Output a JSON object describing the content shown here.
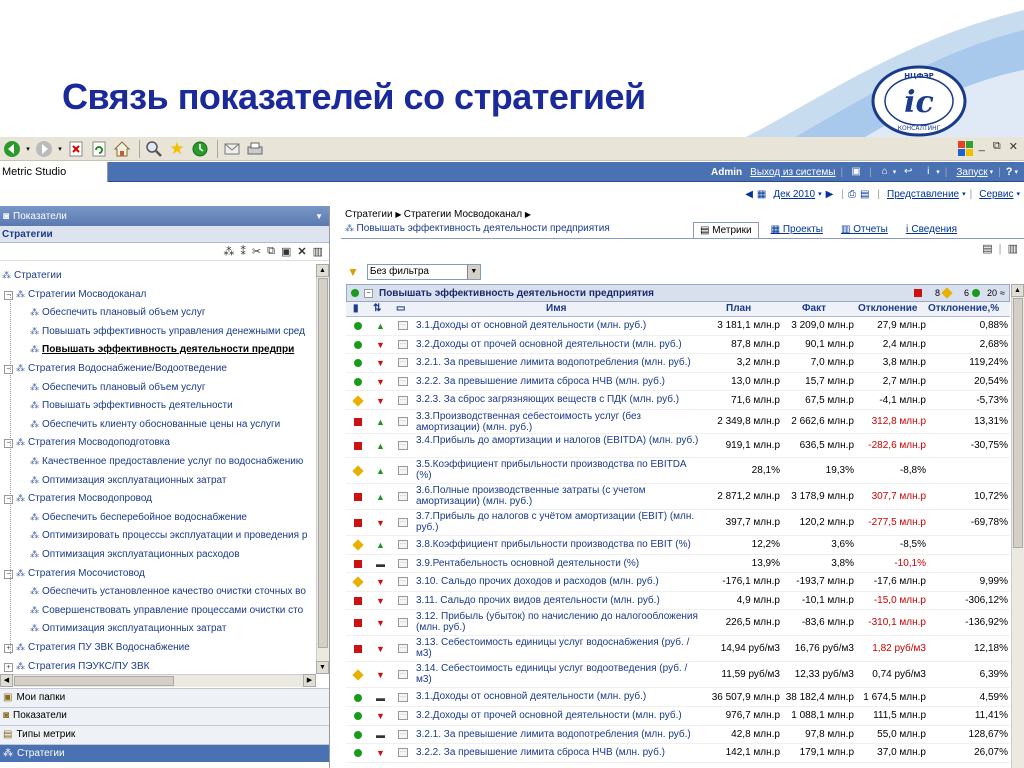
{
  "slide": {
    "title": "Связь показателей со стратегией"
  },
  "app": {
    "name": "Metric Studio",
    "user": "Admin",
    "logout": "Выход из системы",
    "launch": "Запуск"
  },
  "view": {
    "period": "Дек 2010",
    "representation": "Представление",
    "service": "Сервис"
  },
  "left": {
    "panel_title": "Показатели",
    "section_title": "Стратегии",
    "tree": [
      {
        "label": "Стратегии",
        "level": 0,
        "expander": "",
        "selected": false
      },
      {
        "label": "Стратегии Мосводоканал",
        "level": 1,
        "expander": "−",
        "selected": false
      },
      {
        "label": "Обеспечить плановый объем услуг",
        "level": 2,
        "expander": "",
        "selected": false
      },
      {
        "label": "Повышать эффективность управления денежными сред",
        "level": 2,
        "expander": "",
        "selected": false
      },
      {
        "label": "Повышать эффективность деятельности предпри",
        "level": 2,
        "expander": "",
        "selected": true
      },
      {
        "label": "Стратегия Водоснабжение/Водоотведение",
        "level": 1,
        "expander": "−",
        "selected": false
      },
      {
        "label": "Обеспечить плановый объем услуг",
        "level": 2,
        "expander": "",
        "selected": false
      },
      {
        "label": "Повышать эффективность деятельности",
        "level": 2,
        "expander": "",
        "selected": false
      },
      {
        "label": "Обеспечить клиенту обоснованные цены на услуги",
        "level": 2,
        "expander": "",
        "selected": false
      },
      {
        "label": "Стратегия Мосводоподготовка",
        "level": 1,
        "expander": "−",
        "selected": false
      },
      {
        "label": "Качественное предоставление услуг по водоснабжению",
        "level": 2,
        "expander": "",
        "selected": false
      },
      {
        "label": "Оптимизация эксплуатационных затрат",
        "level": 2,
        "expander": "",
        "selected": false
      },
      {
        "label": "Стратегия Мосводопровод",
        "level": 1,
        "expander": "−",
        "selected": false
      },
      {
        "label": "Обеспечить бесперебойное водоснабжение",
        "level": 2,
        "expander": "",
        "selected": false
      },
      {
        "label": "Оптимизировать процессы эксплуатации и проведения р",
        "level": 2,
        "expander": "",
        "selected": false
      },
      {
        "label": "Оптимизация эксплуатационных расходов",
        "level": 2,
        "expander": "",
        "selected": false
      },
      {
        "label": "Стратегия Мосочистовод",
        "level": 1,
        "expander": "−",
        "selected": false
      },
      {
        "label": "Обеспечить установленное качество очистки сточных во",
        "level": 2,
        "expander": "",
        "selected": false
      },
      {
        "label": "Совершенствовать управление процессами очистки сто",
        "level": 2,
        "expander": "",
        "selected": false
      },
      {
        "label": "Оптимизация эксплуатационных затрат",
        "level": 2,
        "expander": "",
        "selected": false
      },
      {
        "label": "Стратегия ПУ ЗВК Водоснабжение",
        "level": 1,
        "expander": "+",
        "selected": false
      },
      {
        "label": "Стратегия ПЭУКС/ПУ ЗВК",
        "level": 1,
        "expander": "+",
        "selected": false
      }
    ],
    "nav": [
      {
        "label": "Мои папки",
        "icon": "folder-icon",
        "active": false
      },
      {
        "label": "Показатели",
        "icon": "metrics-icon",
        "active": false
      },
      {
        "label": "Типы метрик",
        "icon": "metric-types-icon",
        "active": false
      },
      {
        "label": "Стратегии",
        "icon": "strategy-icon",
        "active": true
      }
    ]
  },
  "right": {
    "breadcrumb": [
      "Стратегии",
      "Стратегии Мосводоканал"
    ],
    "object_title": "Повышать эффективность деятельности предприятия",
    "tabs": [
      "Метрики",
      "Проекты",
      "Отчеты",
      "Сведения"
    ],
    "filter": "Без фильтра",
    "grid_title": "Повышать эффективность деятельности предприятия",
    "legend": {
      "red": "8",
      "yellow": "6",
      "green": "20"
    },
    "columns": [
      "Имя",
      "План",
      "Факт",
      "Отклонение",
      "Отклонение,%"
    ],
    "colors": {
      "green": "#1a9a1a",
      "red": "#cc1111",
      "yellow": "#e8b000",
      "negative": "#cc0000"
    },
    "rows": [
      {
        "status": "green",
        "trend": "up",
        "name": "3.1.Доходы от основной деятельности (млн. руб.)",
        "plan": "3 181,1 млн.р",
        "fact": "3 209,0 млн.р",
        "dev": "27,9 млн.р",
        "dev_pct": "0,88%",
        "dev_neg": false
      },
      {
        "status": "green",
        "trend": "down",
        "name": "3.2.Доходы от прочей основной деятельности (млн. руб.)",
        "plan": "87,8 млн.р",
        "fact": "90,1 млн.р",
        "dev": "2,4 млн.р",
        "dev_pct": "2,68%",
        "dev_neg": false
      },
      {
        "status": "green",
        "trend": "down",
        "name": "3.2.1. За превышение лимита водопотребления (млн. руб.)",
        "plan": "3,2 млн.р",
        "fact": "7,0 млн.р",
        "dev": "3,8 млн.р",
        "dev_pct": "119,24%",
        "dev_neg": false
      },
      {
        "status": "green",
        "trend": "down",
        "name": "3.2.2. За превышение лимита сброса НЧВ (млн. руб.)",
        "plan": "13,0 млн.р",
        "fact": "15,7 млн.р",
        "dev": "2,7 млн.р",
        "dev_pct": "20,54%",
        "dev_neg": false
      },
      {
        "status": "yellow",
        "trend": "down",
        "name": "3.2.3. За сброс загрязняющих веществ с ПДК (млн. руб.)",
        "plan": "71,6 млн.р",
        "fact": "67,5 млн.р",
        "dev": "-4,1 млн.р",
        "dev_pct": "-5,73%",
        "dev_neg": false
      },
      {
        "status": "red",
        "trend": "up",
        "name": "3.3.Производственная себестоимость услуг (без амортизации) (млн. руб.)",
        "plan": "2 349,8 млн.р",
        "fact": "2 662,6 млн.р",
        "dev": "312,8 млн.р",
        "dev_pct": "13,31%",
        "dev_neg": true
      },
      {
        "status": "red",
        "trend": "up",
        "name": "3.4.Прибыль до амортизации и налогов (EBITDA) (млн. руб.)",
        "plan": "919,1 млн.р",
        "fact": "636,5 млн.р",
        "dev": "-282,6 млн.р",
        "dev_pct": "-30,75%",
        "dev_neg": true
      },
      {
        "status": "yellow",
        "trend": "up",
        "name": "3.5.Коэффициент прибыльности производства по EBITDA (%)",
        "plan": "28,1%",
        "fact": "19,3%",
        "dev": "-8,8%",
        "dev_pct": "",
        "dev_neg": false
      },
      {
        "status": "red",
        "trend": "up",
        "name": "3.6.Полные производственные затраты (с учетом амортизации) (млн. руб.)",
        "plan": "2 871,2 млн.р",
        "fact": "3 178,9 млн.р",
        "dev": "307,7 млн.р",
        "dev_pct": "10,72%",
        "dev_neg": true
      },
      {
        "status": "red",
        "trend": "down",
        "name": "3.7.Прибыль до налогов с учётом амортизации (EBIT) (млн. руб.)",
        "plan": "397,7 млн.р",
        "fact": "120,2 млн.р",
        "dev": "-277,5 млн.р",
        "dev_pct": "-69,78%",
        "dev_neg": true
      },
      {
        "status": "yellow",
        "trend": "up",
        "name": "3.8.Коэффициент прибыльности производства по EBIT (%)",
        "plan": "12,2%",
        "fact": "3,6%",
        "dev": "-8,5%",
        "dev_pct": "",
        "dev_neg": false
      },
      {
        "status": "red",
        "trend": "flat",
        "name": "3.9.Рентабельность основной деятельности (%)",
        "plan": "13,9%",
        "fact": "3,8%",
        "dev": "-10,1%",
        "dev_pct": "",
        "dev_neg": true
      },
      {
        "status": "yellow",
        "trend": "down",
        "name": "3.10. Сальдо прочих доходов и расходов (млн. руб.)",
        "plan": "-176,1 млн.р",
        "fact": "-193,7 млн.р",
        "dev": "-17,6 млн.р",
        "dev_pct": "9,99%",
        "dev_neg": false
      },
      {
        "status": "red",
        "trend": "down",
        "name": "3.11. Сальдо прочих видов деятельности (млн. руб.)",
        "plan": "4,9 млн.р",
        "fact": "-10,1 млн.р",
        "dev": "-15,0 млн.р",
        "dev_pct": "-306,12%",
        "dev_neg": true
      },
      {
        "status": "red",
        "trend": "down",
        "name": "3.12. Прибыль (убыток) по начислению до налогообложения (млн. руб.)",
        "plan": "226,5 млн.р",
        "fact": "-83,6 млн.р",
        "dev": "-310,1 млн.р",
        "dev_pct": "-136,92%",
        "dev_neg": true
      },
      {
        "status": "red",
        "trend": "down",
        "name": "3.13. Себестоимость единицы услуг водоснабжения (руб. / м3)",
        "plan": "14,94 руб/м3",
        "fact": "16,76 руб/м3",
        "dev": "1,82 руб/м3",
        "dev_pct": "12,18%",
        "dev_neg": true
      },
      {
        "status": "yellow",
        "trend": "down",
        "name": "3.14. Себестоимость единицы услуг водоотведения (руб. / м3)",
        "plan": "11,59 руб/м3",
        "fact": "12,33 руб/м3",
        "dev": "0,74 руб/м3",
        "dev_pct": "6,39%",
        "dev_neg": false
      },
      {
        "status": "green",
        "trend": "flat",
        "name": "3.1.Доходы от основной деятельности (млн. руб.)",
        "plan": "36 507,9 млн.р",
        "fact": "38 182,4 млн.р",
        "dev": "1 674,5 млн.р",
        "dev_pct": "4,59%",
        "dev_neg": false
      },
      {
        "status": "green",
        "trend": "down",
        "name": "3.2.Доходы от прочей основной деятельности (млн. руб.)",
        "plan": "976,7 млн.р",
        "fact": "1 088,1 млн.р",
        "dev": "111,5 млн.р",
        "dev_pct": "11,41%",
        "dev_neg": false
      },
      {
        "status": "green",
        "trend": "flat",
        "name": "3.2.1. За превышение лимита водопотребления (млн. руб.)",
        "plan": "42,8 млн.р",
        "fact": "97,8 млн.р",
        "dev": "55,0 млн.р",
        "dev_pct": "128,67%",
        "dev_neg": false
      },
      {
        "status": "green",
        "trend": "down",
        "name": "3.2.2. За превышение лимита сброса НЧВ (млн. руб.)",
        "plan": "142,1 млн.р",
        "fact": "179,1 млн.р",
        "dev": "37,0 млн.р",
        "dev_pct": "26,07%",
        "dev_neg": false
      }
    ]
  }
}
